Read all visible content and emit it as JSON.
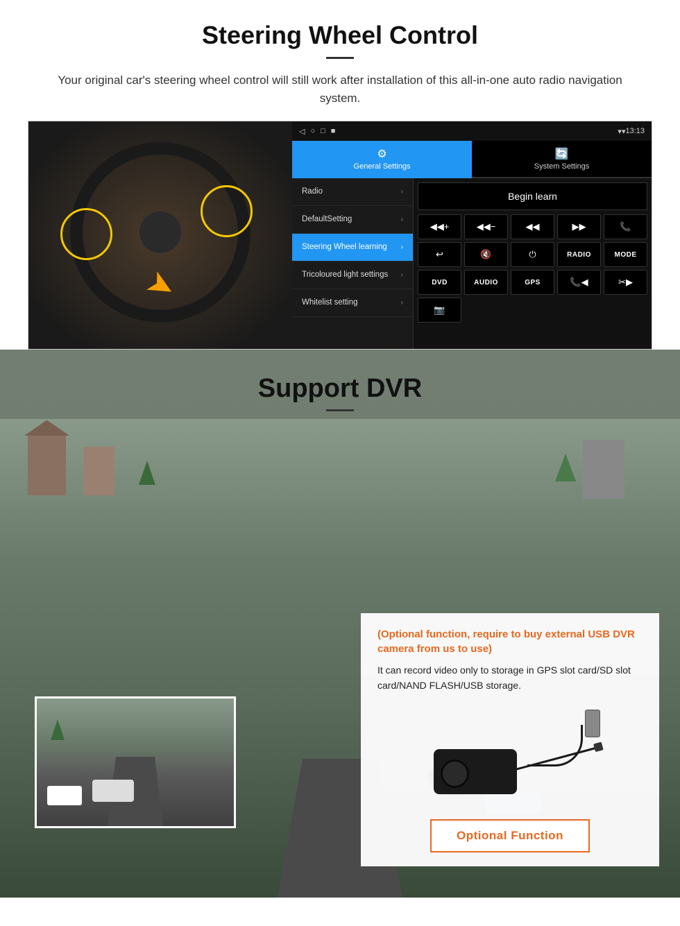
{
  "steering": {
    "title": "Steering Wheel Control",
    "subtitle": "Your original car's steering wheel control will still work after installation of this all-in-one auto radio navigation system.",
    "statusbar": {
      "time": "13:13",
      "icons": [
        "◁",
        "○",
        "□",
        "■"
      ]
    },
    "tabs": [
      {
        "label": "General Settings",
        "icon": "⚙",
        "active": true
      },
      {
        "label": "System Settings",
        "icon": "🔄",
        "active": false
      }
    ],
    "menu_items": [
      {
        "label": "Radio",
        "active": false
      },
      {
        "label": "DefaultSetting",
        "active": false
      },
      {
        "label": "Steering Wheel learning",
        "active": true
      },
      {
        "label": "Tricoloured light settings",
        "active": false
      },
      {
        "label": "Whitelist setting",
        "active": false
      }
    ],
    "begin_learn": "Begin learn",
    "controls": [
      {
        "label": "◀◀+",
        "type": "icon"
      },
      {
        "label": "◀◀−",
        "type": "icon"
      },
      {
        "label": "◀◀",
        "type": "icon"
      },
      {
        "label": "▶▶",
        "type": "icon"
      },
      {
        "label": "📞",
        "type": "icon"
      },
      {
        "label": "↩",
        "type": "icon"
      },
      {
        "label": "🔇",
        "type": "icon"
      },
      {
        "label": "⏻",
        "type": "icon"
      },
      {
        "label": "RADIO",
        "type": "text"
      },
      {
        "label": "MODE",
        "type": "text"
      },
      {
        "label": "DVD",
        "type": "text"
      },
      {
        "label": "AUDIO",
        "type": "text"
      },
      {
        "label": "GPS",
        "type": "text"
      },
      {
        "label": "📞◀◀",
        "type": "icon"
      },
      {
        "label": "✂▶▶",
        "type": "icon"
      },
      {
        "label": "📷",
        "type": "icon"
      }
    ]
  },
  "dvr": {
    "title": "Support DVR",
    "info_orange": "(Optional function, require to buy external USB DVR camera from us to use)",
    "info_text": "It can record video only to storage in GPS slot card/SD slot card/NAND FLASH/USB storage.",
    "optional_button": "Optional Function"
  }
}
